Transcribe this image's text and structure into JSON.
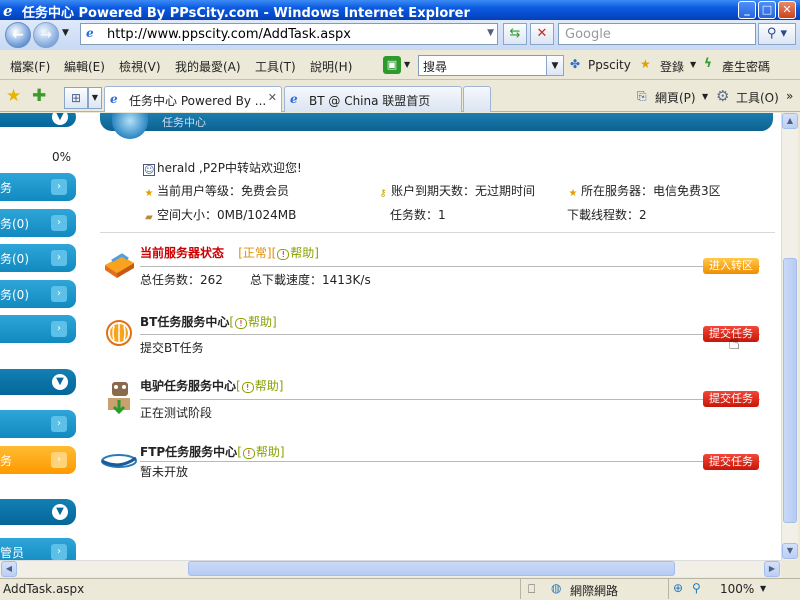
{
  "window": {
    "title": "任务中心 Powered By PPsCity.com - Windows Internet Explorer",
    "minimize": "_",
    "maximize": "□",
    "close": "✕"
  },
  "address": {
    "url": "http://www.ppscity.com/AddTask.aspx",
    "search_placeholder": "Google"
  },
  "menu": {
    "items": [
      "檔案(F)",
      "編輯(E)",
      "檢視(V)",
      "我的最愛(A)",
      "工具(T)",
      "說明(H)"
    ],
    "search_field": "搜尋",
    "ppscity": "Ppscity",
    "login": "登錄",
    "password": "產生密碼"
  },
  "tabs": [
    {
      "label": "任务中心 Powered By ..."
    },
    {
      "label": "BT @ China 联盟首页"
    }
  ],
  "toolbar": {
    "page": "網頁(P)",
    "tools": "工具(O)"
  },
  "sidebar": {
    "percent": "0%",
    "buttons": [
      "务",
      "务(0)",
      "务(0)",
      "务(0)",
      "",
      "",
      "务",
      "",
      "管员"
    ]
  },
  "header": {
    "section_title": "任务中心"
  },
  "user_info": {
    "welcome": "herald ,P2P中转站欢迎您!",
    "level": "当前用户等级：免费会员",
    "expiry": "账户到期天数：无过期时间",
    "server": "所在服务器：电信免费3区",
    "space": "空间大小：0MB/1024MB",
    "task_count": "任务数：1",
    "threads": "下載线程数：2"
  },
  "services": [
    {
      "title": "当前服务器状态",
      "status": "[正常]",
      "help": "帮助",
      "line1": "总任务数：262",
      "line2": "总下載速度：1413K/s",
      "button": "进入转区"
    },
    {
      "title": "BT任务服务中心",
      "help": "帮助",
      "line1": "提交BT任务",
      "button": "提交任务"
    },
    {
      "title": "电驴任务服务中心",
      "help": "帮助",
      "line1": "正在测试阶段",
      "button": "提交任务"
    },
    {
      "title": "FTP任务服务中心",
      "help": "帮助",
      "line1": "暂未开放",
      "button": "提交任务"
    }
  ],
  "status_bar": {
    "left": "AddTask.aspx",
    "zone": "網際網路",
    "zoom": "100%"
  },
  "colors": {
    "ie_blue": "#0a5ae0",
    "sidebar_blue": "#1a9bd0",
    "sidebar_orange": "#ff9a00",
    "service_red": "#cc0000",
    "button_red": "#d42010",
    "button_orange": "#f5a000",
    "help_green": "#8aa000"
  }
}
